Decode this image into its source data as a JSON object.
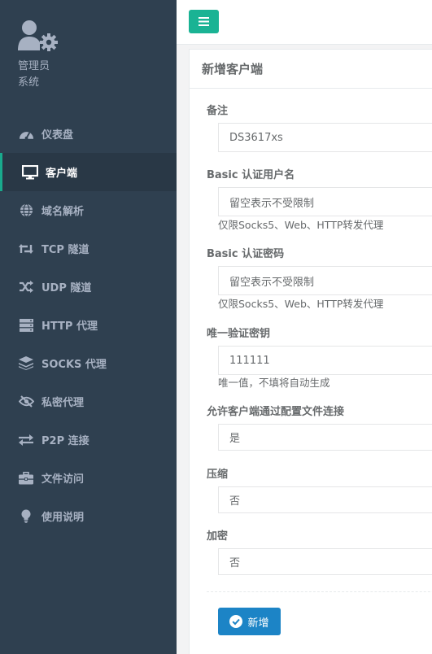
{
  "user": {
    "name": "管理员",
    "role": "系统"
  },
  "sidebar": {
    "items": [
      {
        "label": "仪表盘",
        "icon": "dashboard-icon"
      },
      {
        "label": "客户端",
        "icon": "desktop-icon"
      },
      {
        "label": "域名解析",
        "icon": "globe-icon"
      },
      {
        "label": "TCP 隧道",
        "icon": "retweet-icon"
      },
      {
        "label": "UDP 隧道",
        "icon": "random-icon"
      },
      {
        "label": "HTTP 代理",
        "icon": "server-icon"
      },
      {
        "label": "SOCKS 代理",
        "icon": "layers-icon"
      },
      {
        "label": "私密代理",
        "icon": "eye-slash-icon"
      },
      {
        "label": "P2P 连接",
        "icon": "exchange-icon"
      },
      {
        "label": "文件访问",
        "icon": "briefcase-icon"
      },
      {
        "label": "使用说明",
        "icon": "lightbulb-icon"
      }
    ],
    "active_index": 1
  },
  "colors": {
    "sidebar_bg": "#2f4050",
    "accent": "#1ab394",
    "primary_button": "#1c84c6"
  },
  "panel": {
    "title": "新增客户端"
  },
  "form": {
    "remark": {
      "label": "备注",
      "value": "DS3617xs"
    },
    "basic_user": {
      "label": "Basic 认证用户名",
      "placeholder": "留空表示不受限制",
      "help": "仅限Socks5、Web、HTTP转发代理"
    },
    "basic_pass": {
      "label": "Basic 认证密码",
      "placeholder": "留空表示不受限制",
      "help": "仅限Socks5、Web、HTTP转发代理"
    },
    "vkey": {
      "label": "唯一验证密钥",
      "value": "111111",
      "help": "唯一值，不填将自动生成"
    },
    "config_conn": {
      "label": "允许客户端通过配置文件连接",
      "value": "是"
    },
    "compress": {
      "label": "压缩",
      "value": "否"
    },
    "crypt": {
      "label": "加密",
      "value": "否"
    },
    "submit_label": "新增"
  }
}
